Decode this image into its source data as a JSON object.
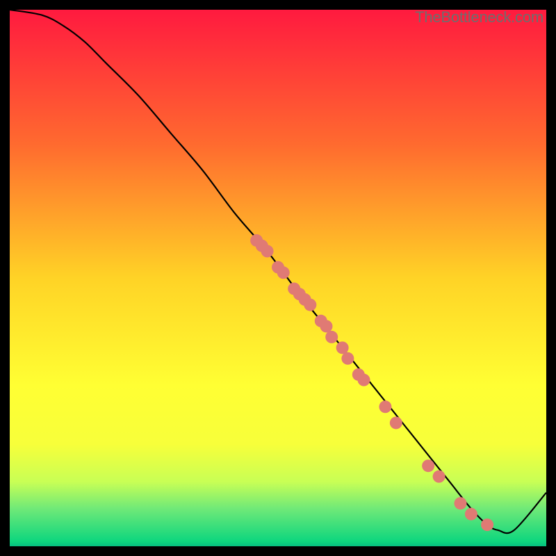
{
  "watermark": "TheBottleneck.com",
  "chart_data": {
    "type": "line",
    "title": "",
    "xlabel": "",
    "ylabel": "",
    "xlim": [
      0,
      100
    ],
    "ylim": [
      0,
      100
    ],
    "background_gradient": {
      "stops": [
        {
          "pos": 0.0,
          "color": "#ff1a3f"
        },
        {
          "pos": 0.25,
          "color": "#ff6a2f"
        },
        {
          "pos": 0.5,
          "color": "#ffd326"
        },
        {
          "pos": 0.7,
          "color": "#ffff33"
        },
        {
          "pos": 0.81,
          "color": "#f7ff3a"
        },
        {
          "pos": 0.88,
          "color": "#c8ff55"
        },
        {
          "pos": 0.93,
          "color": "#6fe978"
        },
        {
          "pos": 0.99,
          "color": "#0fd67e"
        },
        {
          "pos": 1.0,
          "color": "#05c080"
        }
      ]
    },
    "curve": {
      "x": [
        0,
        6,
        10,
        14,
        18,
        24,
        30,
        36,
        42,
        48,
        54,
        58,
        62,
        66,
        70,
        74,
        78,
        82,
        86,
        89,
        91,
        94,
        100
      ],
      "y": [
        100,
        99,
        97,
        94,
        90,
        84,
        77,
        70,
        62,
        55,
        47,
        42,
        37,
        32,
        27,
        22,
        17,
        12,
        7,
        4,
        3,
        3,
        10
      ]
    },
    "points": {
      "x": [
        46,
        47,
        48,
        50,
        51,
        53,
        54,
        55,
        56,
        58,
        59,
        60,
        62,
        63,
        65,
        66,
        70,
        72,
        78,
        80,
        84,
        86,
        89
      ],
      "y": [
        57,
        56,
        55,
        52,
        51,
        48,
        47,
        46,
        45,
        42,
        41,
        39,
        37,
        35,
        32,
        31,
        26,
        23,
        15,
        13,
        8,
        6,
        4
      ],
      "color": "#e07a74",
      "radius": 9
    }
  }
}
